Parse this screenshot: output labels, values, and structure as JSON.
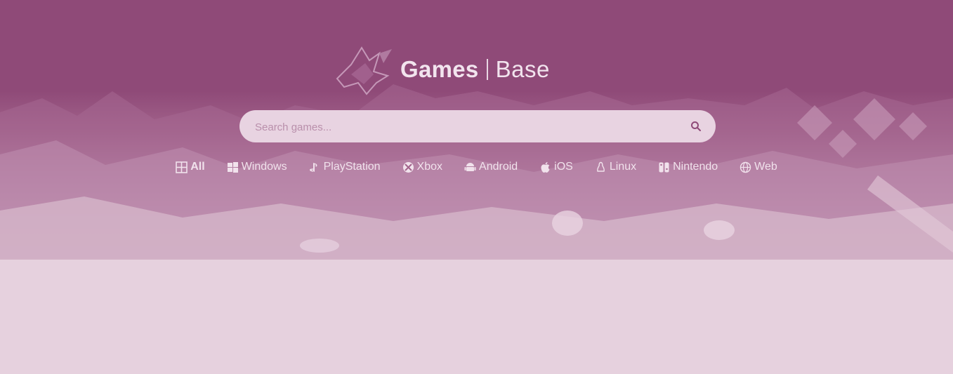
{
  "brand": {
    "name_bold": "Games",
    "name_light": "Base"
  },
  "search": {
    "placeholder": "Search games..."
  },
  "platforms": [
    {
      "label": "All",
      "icon": "grid-icon",
      "active": true
    },
    {
      "label": "Windows",
      "icon": "windows-icon",
      "active": false
    },
    {
      "label": "PlayStation",
      "icon": "playstation-icon",
      "active": false
    },
    {
      "label": "Xbox",
      "icon": "xbox-icon",
      "active": false
    },
    {
      "label": "Android",
      "icon": "android-icon",
      "active": false
    },
    {
      "label": "iOS",
      "icon": "apple-icon",
      "active": false
    },
    {
      "label": "Linux",
      "icon": "linux-icon",
      "active": false
    },
    {
      "label": "Nintendo",
      "icon": "nintendo-icon",
      "active": false
    },
    {
      "label": "Web",
      "icon": "globe-icon",
      "active": false
    }
  ],
  "colors": {
    "header_bg": "#8f4a78",
    "page_bg": "#e6d1de",
    "search_bg": "#e8d3e1",
    "text_light": "#f1e2ec"
  }
}
